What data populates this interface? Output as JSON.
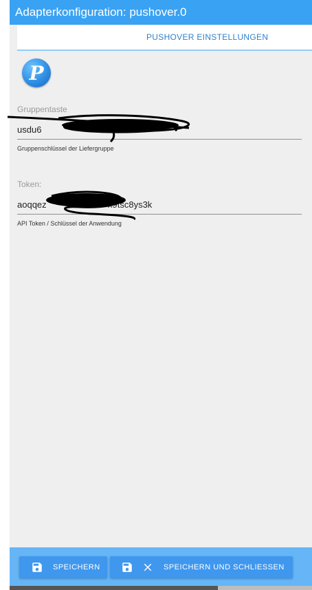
{
  "window": {
    "title": "Adapterkonfiguration: pushover.0"
  },
  "tabs": [
    {
      "label": "PUSHOVER EINSTELLUNGEN",
      "active": true
    }
  ],
  "logo": {
    "icon": "pushover-logo-icon",
    "letter": "P"
  },
  "fields": [
    {
      "label": "Gruppentaste",
      "value": "usdu6",
      "help": "Gruppenschlüssel der Liefergruppe"
    },
    {
      "label": "Token:",
      "value": "aoqqez",
      "value_end": "x9tsc8ys3k",
      "help": "API Token / Schlüssel der Anwendung"
    }
  ],
  "footer": {
    "save": {
      "label": "SPEICHERN",
      "icon": "save-icon"
    },
    "save_close": {
      "label": "SPEICHERN UND SCHLIESSEN",
      "icons": [
        "save-icon",
        "close-icon"
      ]
    }
  },
  "colors": {
    "accent": "#3aa2f3",
    "footer": "#66b6f7",
    "button": "#3f97ee",
    "panel": "#efefef"
  }
}
